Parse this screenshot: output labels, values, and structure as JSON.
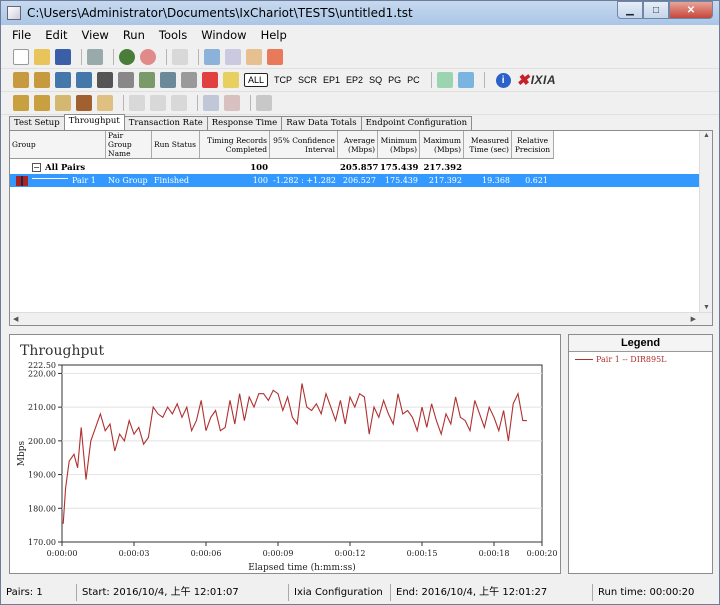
{
  "window": {
    "title": "C:\\Users\\Administrator\\Documents\\IxChariot\\TESTS\\untitled1.tst"
  },
  "menu": [
    "File",
    "Edit",
    "View",
    "Run",
    "Tools",
    "Window",
    "Help"
  ],
  "toolbar2": {
    "protocols": [
      "ALL",
      "TCP",
      "SCR",
      "EP1",
      "EP2",
      "SQ",
      "PG",
      "PC"
    ],
    "brand": "IXIA"
  },
  "tabs": [
    "Test Setup",
    "Throughput",
    "Transaction Rate",
    "Response Time",
    "Raw Data Totals",
    "Endpoint Configuration"
  ],
  "grid": {
    "headers": [
      [
        "Group"
      ],
      [
        "Pair Group",
        "Name"
      ],
      [
        "Run Status"
      ],
      [
        "Timing Records",
        "Completed"
      ],
      [
        "95% Confidence",
        "Interval"
      ],
      [
        "Average",
        "(Mbps)"
      ],
      [
        "Minimum",
        "(Mbps)"
      ],
      [
        "Maximum",
        "(Mbps)"
      ],
      [
        "Measured",
        "Time (sec)"
      ],
      [
        "Relative",
        "Precision"
      ]
    ],
    "all_pairs": {
      "expander": "−",
      "label": "All Pairs",
      "records": "100",
      "average": "205.857",
      "minimum": "175.439",
      "maximum": "217.392"
    },
    "pair1": {
      "label": "Pair 1",
      "group": "No Group",
      "status": "Finished",
      "records": "100",
      "ci": "-1.282 : +1.282",
      "average": "206.527",
      "minimum": "175.439",
      "maximum": "217.392",
      "time": "19.368",
      "precision": "0.621"
    }
  },
  "chart_title": "Throughput",
  "legend": {
    "title": "Legend",
    "entries": [
      "Pair 1 -- DIR895L"
    ]
  },
  "chart_data": {
    "type": "line",
    "xlabel": "Elapsed time (h:mm:ss)",
    "ylabel": "Mbps",
    "xlim": [
      0,
      20
    ],
    "ylim": [
      170,
      222.5
    ],
    "y_ticks": [
      "222.50",
      "220.00",
      "210.00",
      "200.00",
      "190.00",
      "180.00",
      "170.00"
    ],
    "y_tick_values": [
      222.5,
      220,
      210,
      200,
      190,
      180,
      170
    ],
    "x_ticks": [
      "0:00:00",
      "0:00:03",
      "0:00:06",
      "0:00:09",
      "0:00:12",
      "0:00:15",
      "0:00:18",
      "0:00:20"
    ],
    "x_tick_values": [
      0,
      3,
      6,
      9,
      12,
      15,
      18,
      20
    ],
    "series": [
      {
        "name": "Pair 1 -- DIR895L",
        "color": "#b03030",
        "x": [
          0.05,
          0.15,
          0.3,
          0.5,
          0.65,
          0.8,
          1.0,
          1.2,
          1.4,
          1.6,
          1.8,
          2.0,
          2.2,
          2.4,
          2.6,
          2.8,
          3.0,
          3.2,
          3.4,
          3.6,
          3.8,
          4.0,
          4.2,
          4.4,
          4.6,
          4.8,
          5.0,
          5.2,
          5.4,
          5.6,
          5.8,
          6.0,
          6.2,
          6.4,
          6.6,
          6.8,
          7.0,
          7.2,
          7.4,
          7.6,
          7.8,
          8.0,
          8.2,
          8.4,
          8.6,
          8.8,
          9.0,
          9.2,
          9.4,
          9.6,
          9.8,
          10.0,
          10.2,
          10.4,
          10.6,
          10.8,
          11.0,
          11.2,
          11.4,
          11.6,
          11.8,
          12.0,
          12.2,
          12.4,
          12.6,
          12.8,
          13.0,
          13.2,
          13.4,
          13.6,
          13.8,
          14.0,
          14.2,
          14.4,
          14.6,
          14.8,
          15.0,
          15.2,
          15.4,
          15.6,
          15.8,
          16.0,
          16.2,
          16.4,
          16.6,
          16.8,
          17.0,
          17.2,
          17.4,
          17.6,
          17.8,
          18.0,
          18.2,
          18.4,
          18.6,
          18.8,
          19.0,
          19.2,
          19.37
        ],
        "y": [
          175.4,
          186,
          194,
          196,
          192,
          204,
          188.5,
          200,
          204,
          208,
          203,
          205,
          197,
          202,
          200,
          206,
          202,
          204,
          199,
          201,
          210,
          208,
          207,
          210,
          208,
          211,
          207,
          210,
          203,
          206,
          212,
          203,
          207,
          209,
          203,
          204,
          212,
          205,
          214,
          206,
          213,
          210,
          214,
          214,
          212,
          215,
          214,
          209,
          213,
          207,
          205,
          217,
          210,
          209,
          211,
          208,
          214,
          210,
          206,
          212,
          205,
          213,
          210,
          214,
          213,
          202,
          210,
          207,
          212,
          208,
          205,
          214,
          208,
          209,
          207,
          203,
          210,
          204,
          211,
          206,
          202,
          208,
          205,
          213,
          207,
          206,
          203,
          212,
          208,
          204,
          210,
          207,
          203,
          209,
          200,
          211,
          214,
          206,
          206
        ]
      }
    ]
  },
  "status": {
    "pairs": "Pairs: 1",
    "start": "Start: 2016/10/4, 上午 12:01:07",
    "config": "Ixia Configuration",
    "end": "End: 2016/10/4, 上午 12:01:27",
    "runtime": "Run time: 00:00:20"
  }
}
